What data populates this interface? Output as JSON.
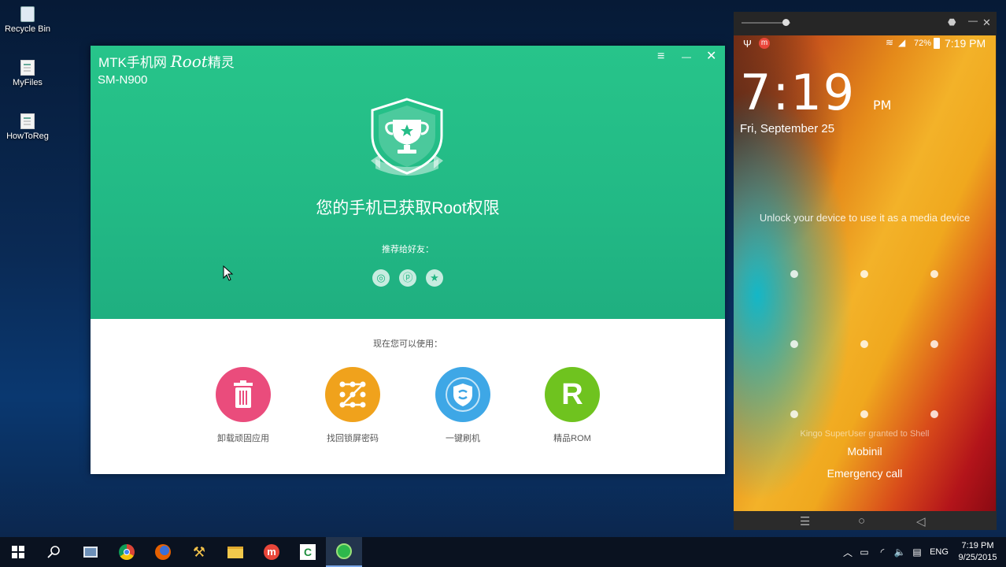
{
  "desktop": {
    "icons": [
      {
        "label": "Recycle Bin"
      },
      {
        "label": "MyFiles"
      },
      {
        "label": "HowToReg"
      }
    ]
  },
  "app": {
    "title_prefix": "MTK手机网",
    "title_root": "Root",
    "title_suffix": "精灵",
    "model": "SM-N900",
    "menu_icon": "≡",
    "minimize_icon": "—",
    "close_icon": "✕",
    "headline": "您的手机已获取Root权限",
    "recommend_label": "推荐给好友：",
    "share_icons": [
      "weibo-icon",
      "qzone-icon",
      "favorite-icon"
    ],
    "now_available_label": "现在您可以使用：",
    "tools": [
      {
        "label": "卸载顽固应用",
        "color": "#ea4c7c",
        "icon": "trash-icon"
      },
      {
        "label": "找回锁屏密码",
        "color": "#f0a21c",
        "icon": "pattern-icon"
      },
      {
        "label": "一键刷机",
        "color": "#3ea7e6",
        "icon": "shield-icon"
      },
      {
        "label": "精品ROM",
        "color": "#6fc31f",
        "icon": "rom-icon",
        "glyph": "R"
      }
    ],
    "accent": "#22b985"
  },
  "phone": {
    "status": {
      "battery": "72%",
      "time": "7:19 PM"
    },
    "clock": "7:19",
    "clock_ampm": "PM",
    "date": "Fri, September 25",
    "unlock_hint": "Unlock your device to use it as a media device",
    "toast": "Kingo SuperUser granted to Shell",
    "carrier": "Mobinil",
    "emergency": "Emergency call"
  },
  "taskbar": {
    "tray_lang": "ENG",
    "time": "7:19 PM",
    "date": "9/25/2015"
  }
}
